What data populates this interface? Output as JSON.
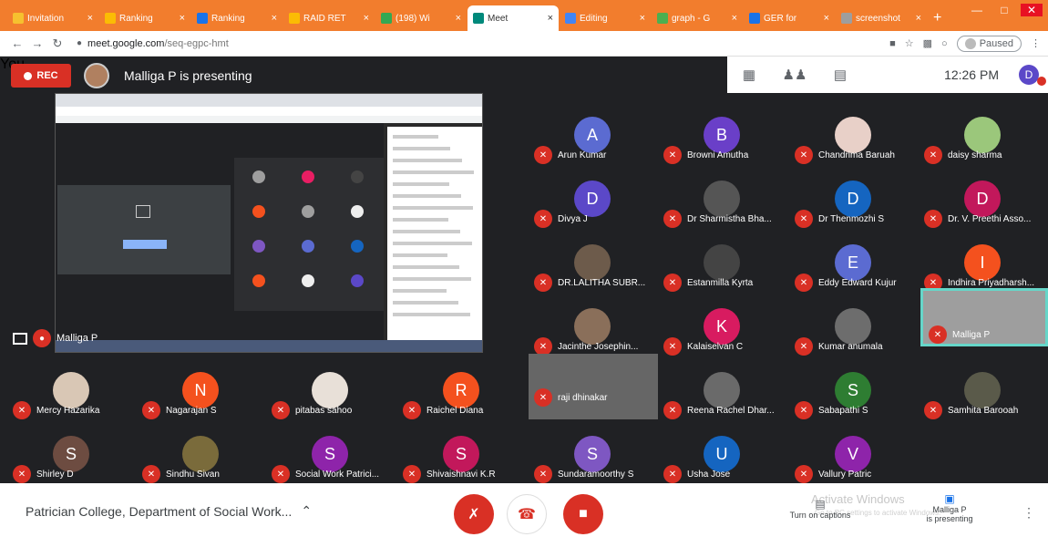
{
  "browser": {
    "tabs": [
      {
        "label": "Invitation",
        "color": "#f6c12f",
        "active": false
      },
      {
        "label": "Ranking",
        "color": "#fbbc04",
        "active": false
      },
      {
        "label": "Ranking",
        "color": "#1a73e8",
        "active": false
      },
      {
        "label": "RAID RET",
        "color": "#fbbc04",
        "active": false
      },
      {
        "label": "(198) Wi",
        "color": "#34a853",
        "active": false
      },
      {
        "label": "Meet",
        "color": "#00897b",
        "active": true
      },
      {
        "label": "Editing",
        "color": "#4285f4",
        "active": false
      },
      {
        "label": "graph - G",
        "color": "#4caf50",
        "active": false
      },
      {
        "label": "GER for",
        "color": "#1a73e8",
        "active": false
      },
      {
        "label": "screenshot",
        "color": "#9e9e9e",
        "active": false
      }
    ],
    "url_domain": "meet.google.com",
    "url_path": "/seq-egpc-hmt",
    "paused_label": "Paused"
  },
  "meet": {
    "rec_label": "REC",
    "presenting_banner": "Malliga P is presenting",
    "clock": "12:26 PM",
    "user_initial": "D",
    "you_label": "You",
    "presenter_tile_label": "Malliga P",
    "meeting_title": "Patrician College, Department of Social Work...",
    "captions_label": "Turn on captions",
    "watermark_line1": "Activate Windows",
    "watermark_line2": "Go to PC settings to activate Windows.",
    "presenting_name": "Malliga P",
    "presenting_status": "is presenting"
  },
  "participants": [
    {
      "name": "Arun Kumar",
      "initial": "A",
      "color": "#5b6bd1"
    },
    {
      "name": "Browni Amutha",
      "initial": "B",
      "color": "#6a3fc8"
    },
    {
      "name": "Chandrima Baruah",
      "initial": "",
      "color": "#e8d0c8"
    },
    {
      "name": "daisy sharma",
      "initial": "",
      "color": "#9bc77b"
    },
    {
      "name": "Divya J",
      "initial": "D",
      "color": "#5b48c8"
    },
    {
      "name": "Dr Sharmistha Bha...",
      "initial": "",
      "color": "#555555"
    },
    {
      "name": "Dr Thenmozhi S",
      "initial": "D",
      "color": "#1565c0"
    },
    {
      "name": "Dr. V. Preethi Asso...",
      "initial": "D",
      "color": "#c2185b"
    },
    {
      "name": "DR.LALITHA SUBR...",
      "initial": "",
      "color": "#6d5b4b"
    },
    {
      "name": "Estanmilla Kyrta",
      "initial": "",
      "color": "#444444"
    },
    {
      "name": "Eddy Edward Kujur",
      "initial": "E",
      "color": "#5b6bd1"
    },
    {
      "name": "Indhira Priyadharsh...",
      "initial": "I",
      "color": "#f4511e"
    },
    {
      "name": "Jacinthe Josephin...",
      "initial": "",
      "color": "#8a6f5a"
    },
    {
      "name": "Kalaiselvan C",
      "initial": "K",
      "color": "#d81b60"
    },
    {
      "name": "Kumar anumala",
      "initial": "",
      "color": "#6d6d6d"
    },
    {
      "name": "Malliga P",
      "initial": "",
      "color": "#9e9e9e"
    },
    {
      "name": "Mercy Hazarika",
      "initial": "",
      "color": "#d9c7b5"
    },
    {
      "name": "Nagarajan S",
      "initial": "N",
      "color": "#f4511e"
    },
    {
      "name": "pitabas sahoo",
      "initial": "",
      "color": "#e8e0d8"
    },
    {
      "name": "Raichel Diana",
      "initial": "R",
      "color": "#f4511e"
    },
    {
      "name": "raji dhinakar",
      "initial": "",
      "color": "#707070"
    },
    {
      "name": "Reena Rachel Dhar...",
      "initial": "",
      "color": "#6a6a6a"
    },
    {
      "name": "Sabapathi S",
      "initial": "S",
      "color": "#2e7d32"
    },
    {
      "name": "Samhita Barooah",
      "initial": "",
      "color": "#5a5a4a"
    },
    {
      "name": "Shirley D",
      "initial": "S",
      "color": "#6d4c41"
    },
    {
      "name": "Sindhu Sivan",
      "initial": "",
      "color": "#7a6b3b"
    },
    {
      "name": "Social Work Patrici...",
      "initial": "S",
      "color": "#8e24aa"
    },
    {
      "name": "Shivaishnavi K.R",
      "initial": "S",
      "color": "#c2185b"
    },
    {
      "name": "Sundaramoorthy S",
      "initial": "S",
      "color": "#7e57c2"
    },
    {
      "name": "Usha Jose",
      "initial": "U",
      "color": "#1565c0"
    },
    {
      "name": "Vallury Patric",
      "initial": "V",
      "color": "#8e24aa"
    }
  ]
}
